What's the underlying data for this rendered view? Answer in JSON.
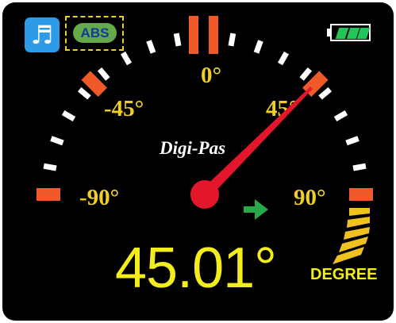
{
  "app": {
    "brand": "Digi-Pas"
  },
  "status_bar": {
    "music_icon": "music-note-icon",
    "music_glyph": "♬",
    "abs_label": "ABS",
    "battery_icon": "battery-full-icon"
  },
  "gauge": {
    "labels": {
      "zero": "0°",
      "neg45": "-45°",
      "pos45": "45°",
      "neg90": "-90°",
      "pos90": "90°"
    },
    "range": [
      -90,
      90
    ],
    "needle_value": 45.01
  },
  "readout": {
    "value": "45.01°",
    "unit": "DEGREE"
  },
  "colors": {
    "background": "#000000",
    "label": "#f0cf25",
    "needle": "#e3162c",
    "marker": "#f05a28",
    "tick": "#ffffff",
    "battery": "#23c45a",
    "arrow": "#2aa845",
    "reading": "#f3ed1c"
  }
}
